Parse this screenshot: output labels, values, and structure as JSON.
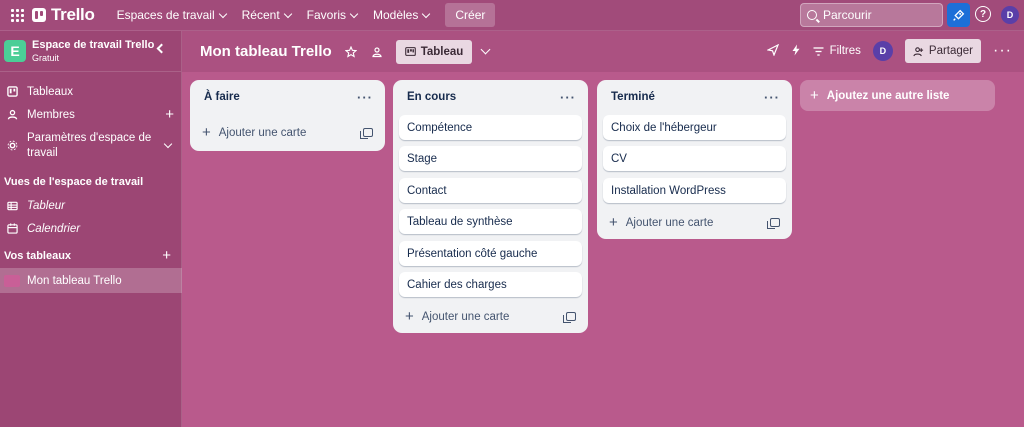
{
  "topbar": {
    "logo": "Trello",
    "nav": [
      {
        "label": "Espaces de travail"
      },
      {
        "label": "Récent"
      },
      {
        "label": "Favoris"
      },
      {
        "label": "Modèles"
      }
    ],
    "create_label": "Créer",
    "search_placeholder": "Parcourir",
    "avatar_initial": "D"
  },
  "sidebar": {
    "workspace_badge": "E",
    "workspace_name": "Espace de travail Trello",
    "workspace_plan": "Gratuit",
    "items": [
      {
        "label": "Tableaux"
      },
      {
        "label": "Membres"
      },
      {
        "label": "Paramètres d'espace de travail"
      }
    ],
    "views_title": "Vues de l'espace de travail",
    "views": [
      {
        "label": "Tableur"
      },
      {
        "label": "Calendrier"
      }
    ],
    "boards_title": "Vos tableaux",
    "boards": [
      {
        "label": "Mon tableau Trello"
      }
    ]
  },
  "board": {
    "title": "Mon tableau Trello",
    "view_label": "Tableau",
    "filters_label": "Filtres",
    "avatar_initial": "D",
    "share_label": "Partager"
  },
  "lists": [
    {
      "title": "À faire",
      "cards": [],
      "add_label": "Ajouter une carte"
    },
    {
      "title": "En cours",
      "cards": [
        "Compétence",
        "Stage",
        "Contact",
        "Tableau de synthèse",
        "Présentation côté gauche",
        "Cahier des charges"
      ],
      "add_label": "Ajouter une carte"
    },
    {
      "title": "Terminé",
      "cards": [
        "Choix de l'hébergeur",
        "CV",
        "Installation WordPress"
      ],
      "add_label": "Ajouter une carte"
    }
  ],
  "add_list_label": "Ajoutez une autre liste",
  "colors": {
    "board_bg": "#b95a8c",
    "topbar": "#a14b7a",
    "sidebar": "#9c4674",
    "list_bg": "#f1f2f4",
    "workspace_badge": "#4bce97",
    "rocket_button": "#1d6fd8",
    "avatar": "#5a3fa8"
  },
  "icons": [
    "apps-grid-icon",
    "trello-logo-icon",
    "search-icon",
    "rocket-icon",
    "help-icon",
    "board-icon",
    "member-icon",
    "settings-icon",
    "table-icon",
    "calendar-icon",
    "star-icon",
    "people-icon",
    "send-icon",
    "lightning-icon",
    "filter-icon",
    "share-user-icon",
    "more-icon",
    "template-icon"
  ]
}
